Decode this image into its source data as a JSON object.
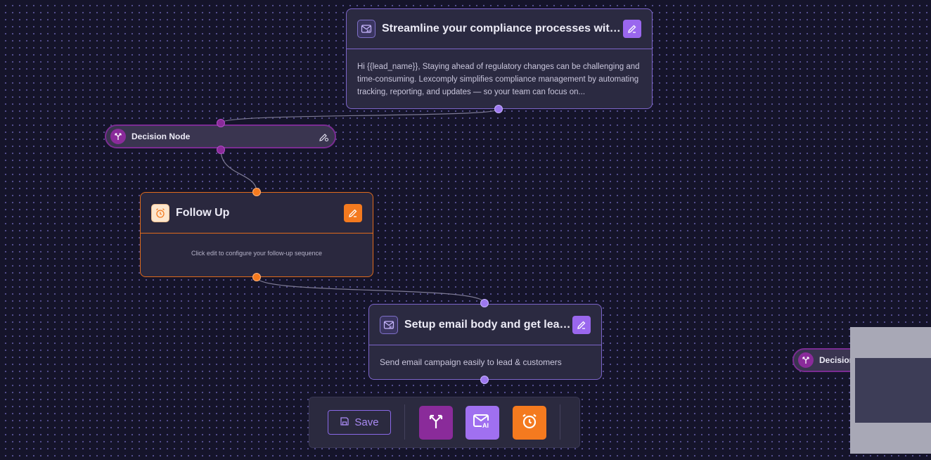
{
  "nodes": {
    "email_top": {
      "title": "Streamline your compliance processes with...",
      "body": "Hi {{lead_name}}, Staying ahead of regulatory changes can be challenging and time-consuming. Lexcomply simplifies compliance management by automating tracking, reporting, and updates — so your team can focus on...",
      "icon": "mail-ai-icon",
      "edit_icon": "edit-icon"
    },
    "decision_1": {
      "label": "Decision Node",
      "icon": "branch-icon",
      "edit_icon": "pencil-gear-icon"
    },
    "follow_up": {
      "title": "Follow Up",
      "body": "Click edit to configure your follow-up sequence",
      "icon": "alarm-clock-icon",
      "edit_icon": "edit-icon"
    },
    "email_bottom": {
      "title": "Setup email body and get leads",
      "body": "Send email campaign easily to lead & customers",
      "icon": "mail-ai-icon",
      "edit_icon": "edit-icon"
    },
    "decision_2": {
      "label": "Decision",
      "icon": "branch-icon"
    }
  },
  "toolbar": {
    "save_label": "Save",
    "save_icon": "floppy-disk-icon",
    "tools": [
      {
        "name": "add-decision-node",
        "icon": "branch-icon",
        "color": "#8a2b9a"
      },
      {
        "name": "add-email-node",
        "icon": "mail-ai-icon",
        "color": "#a070f0"
      },
      {
        "name": "add-follow-up-node",
        "icon": "alarm-clock-icon",
        "color": "#f47a1f"
      }
    ]
  },
  "colors": {
    "canvas_bg": "#15142a",
    "purple_accent": "#9a67ee",
    "orange_accent": "#f47a1f",
    "magenta_accent": "#8a2b9a"
  }
}
